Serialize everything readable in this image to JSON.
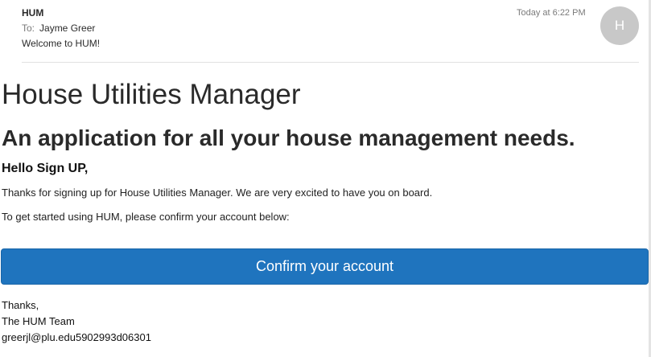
{
  "header": {
    "sender": "HUM",
    "to_label": "To:",
    "to_name": "Jayme Greer",
    "subject": "Welcome to HUM!",
    "timestamp": "Today at 6:22 PM",
    "avatar_initial": "H",
    "avatar_color": "#c8c8c8"
  },
  "body": {
    "title": "House Utilities Manager",
    "tagline": "An application for all your house management needs.",
    "greeting": "Hello Sign UP,",
    "paragraph_1": "Thanks for signing up for House Utilities Manager. We are very excited to have you on board.",
    "paragraph_2": "To get started using HUM, please confirm your account below:",
    "confirm_button_label": "Confirm your account",
    "button_color": "#1f74be",
    "signoff": "Thanks,",
    "signature": "The HUM Team",
    "footer_code": "greerjl@plu.edu5902993d06301"
  }
}
